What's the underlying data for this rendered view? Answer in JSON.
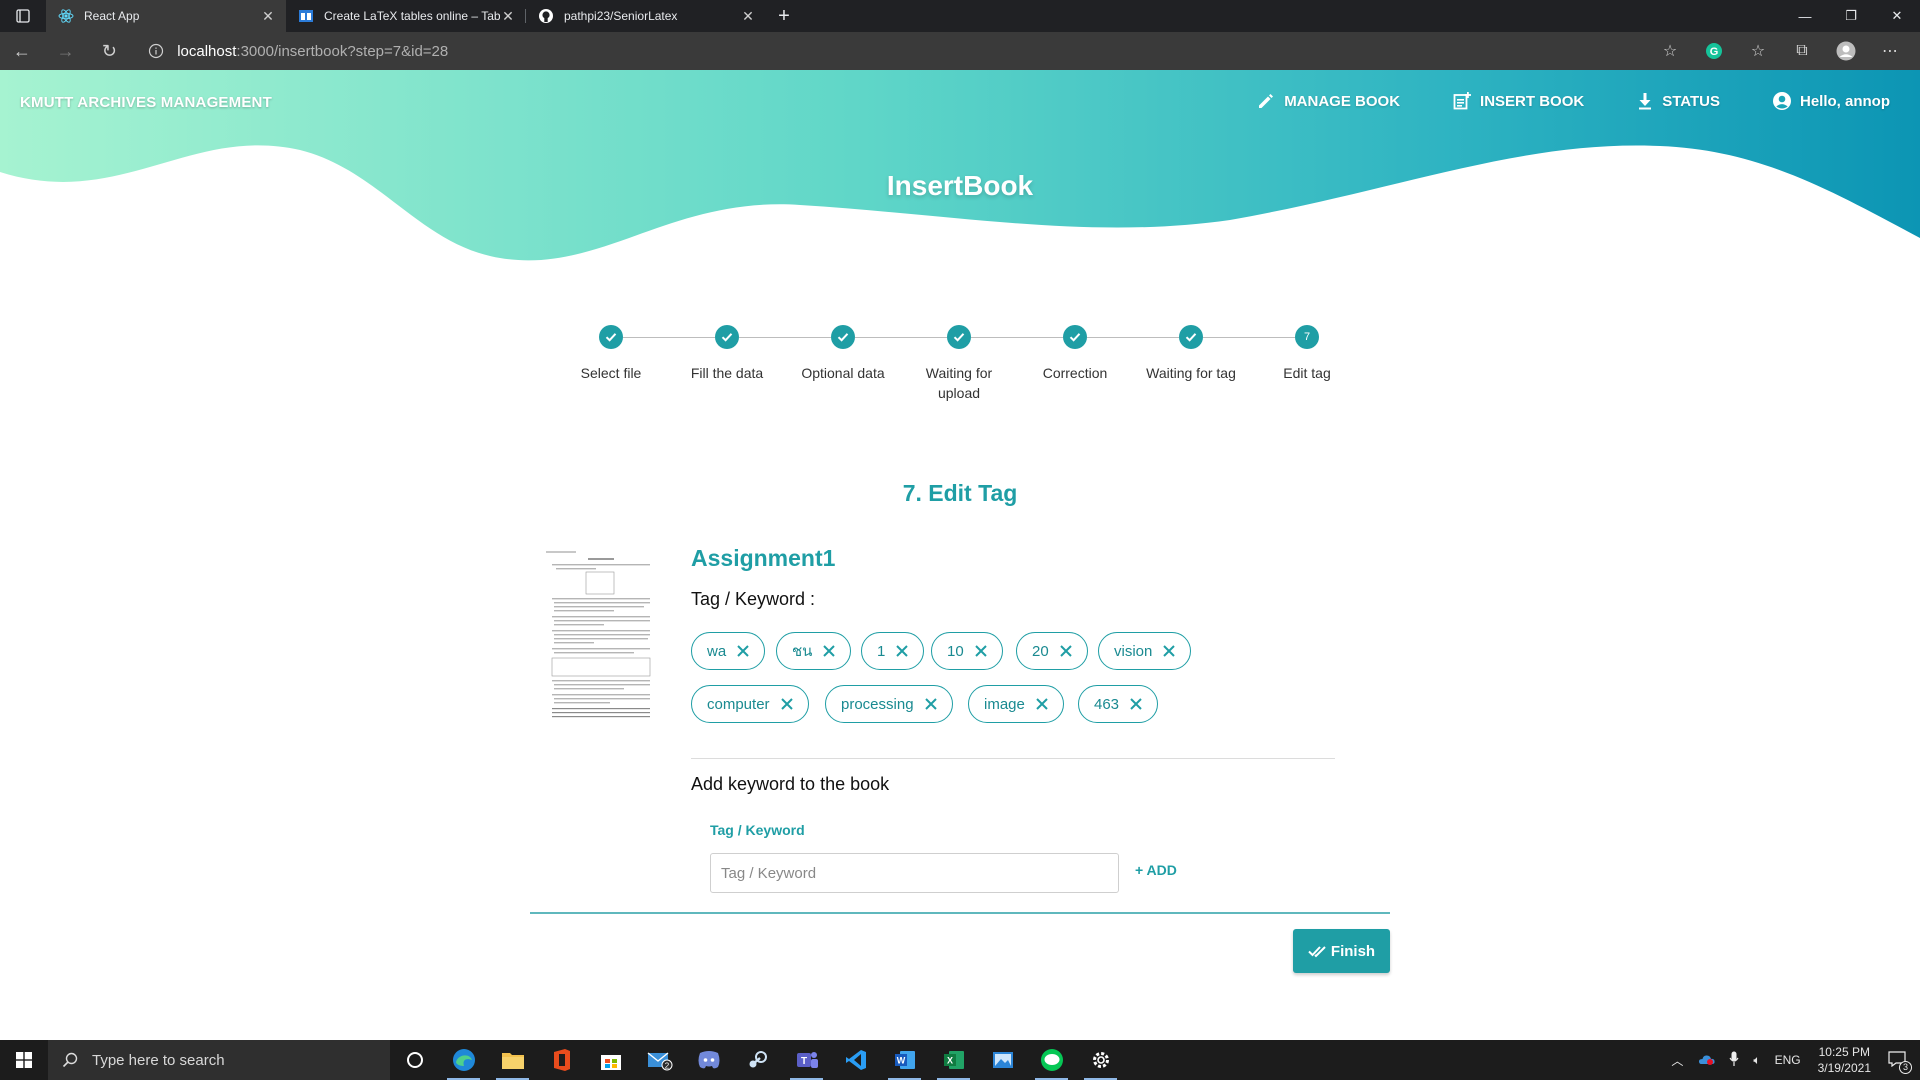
{
  "browser": {
    "tabs": [
      {
        "title": "React App",
        "active": true
      },
      {
        "title": "Create LaTeX tables online – Tabl",
        "active": false
      },
      {
        "title": "pathpi23/SeniorLatex",
        "active": false
      }
    ],
    "url_host": "localhost",
    "url_path": ":3000/insertbook?step=7&id=28"
  },
  "app": {
    "brand": "KMUTT ARCHIVES MANAGEMENT",
    "nav": {
      "manage_book": "MANAGE BOOK",
      "insert_book": "INSERT BOOK",
      "status": "STATUS",
      "user": "Hello, annop"
    },
    "hero_title": "InsertBook",
    "steps": [
      {
        "label": "Select file",
        "done": true
      },
      {
        "label": "Fill the data",
        "done": true
      },
      {
        "label": "Optional data",
        "done": true
      },
      {
        "label": "Waiting for upload",
        "done": true
      },
      {
        "label": "Correction",
        "done": true
      },
      {
        "label": "Waiting for tag",
        "done": true
      },
      {
        "label": "Edit tag",
        "done": false,
        "number": "7"
      }
    ],
    "section_title": "7. Edit Tag",
    "book_title": "Assignment1",
    "tag_label": "Tag / Keyword :",
    "tags": [
      "wa",
      "ชน",
      "1",
      "10",
      "20",
      "vision",
      "computer",
      "processing",
      "image",
      "463"
    ],
    "add_title": "Add keyword to the book",
    "field_label": "Tag / Keyword",
    "field_placeholder": "Tag / Keyword",
    "add_button": "+ ADD",
    "finish_button": "Finish",
    "accent_color": "#1f9ea5"
  },
  "taskbar": {
    "search_placeholder": "Type here to search",
    "apps": [
      "cortana-icon",
      "edge-icon",
      "file-explorer-icon",
      "office-icon",
      "store-icon",
      "mail-icon",
      "discord-icon",
      "steam-icon",
      "teams-icon",
      "vscode-icon",
      "word-icon",
      "excel-icon",
      "photos-icon",
      "line-icon",
      "settings-icon"
    ],
    "mail_badge": "2",
    "teams_label": "T",
    "word_label": "W",
    "excel_label": "X",
    "lang": "ENG",
    "time": "10:25 PM",
    "date": "3/19/2021",
    "notifications": "3"
  }
}
